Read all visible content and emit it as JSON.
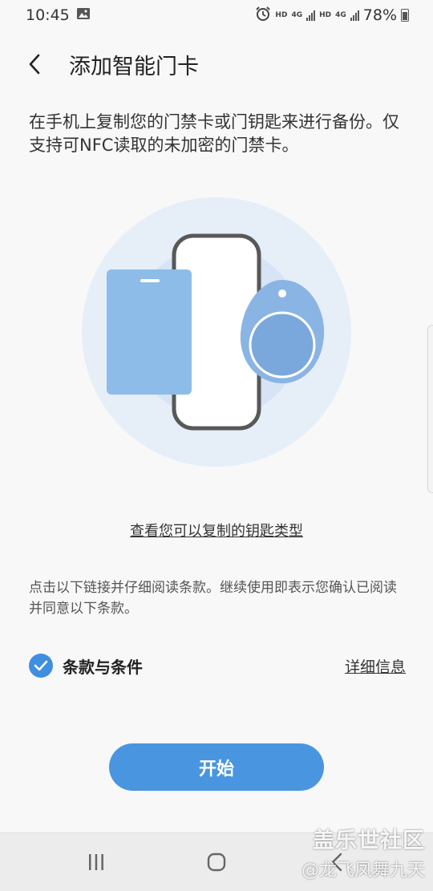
{
  "status_bar": {
    "time": "10:45",
    "hd1": "HD",
    "net1": "4G",
    "hd2": "HD",
    "net2": "4G",
    "battery": "78%",
    "icons": [
      "image-icon",
      "alarm-icon",
      "signal-icon",
      "battery-icon"
    ]
  },
  "header": {
    "title": "添加智能门卡",
    "back_icon": "chevron-left-icon"
  },
  "description": "在手机上复制您的门禁卡或门钥匙来进行备份。仅支持可NFC读取的未加密的门禁卡。",
  "illustration": {
    "icons": [
      "phone-icon",
      "access-card-icon",
      "key-fob-icon"
    ],
    "colors": {
      "outer_circle": "#e6eef8",
      "inner_circle": "#d6e4f5",
      "card": "#8dbce8",
      "fob": "#8ab4e4"
    }
  },
  "links": {
    "key_types": "查看您可以复制的钥匙类型"
  },
  "terms": {
    "note": "点击以下链接并仔细阅读条款。继续使用即表示您确认已阅读并同意以下条款。",
    "checkbox_label": "条款与条件",
    "checked": true,
    "details": "详细信息"
  },
  "start_button": "开始",
  "nav_bar": {
    "icons": [
      "recent-apps-icon",
      "home-icon",
      "back-icon"
    ]
  },
  "watermark": {
    "line1": "盖乐世社区",
    "line2": "@龙飞凤舞九天"
  },
  "colors": {
    "accent": "#4a95e0",
    "background": "#f8f8f8"
  }
}
